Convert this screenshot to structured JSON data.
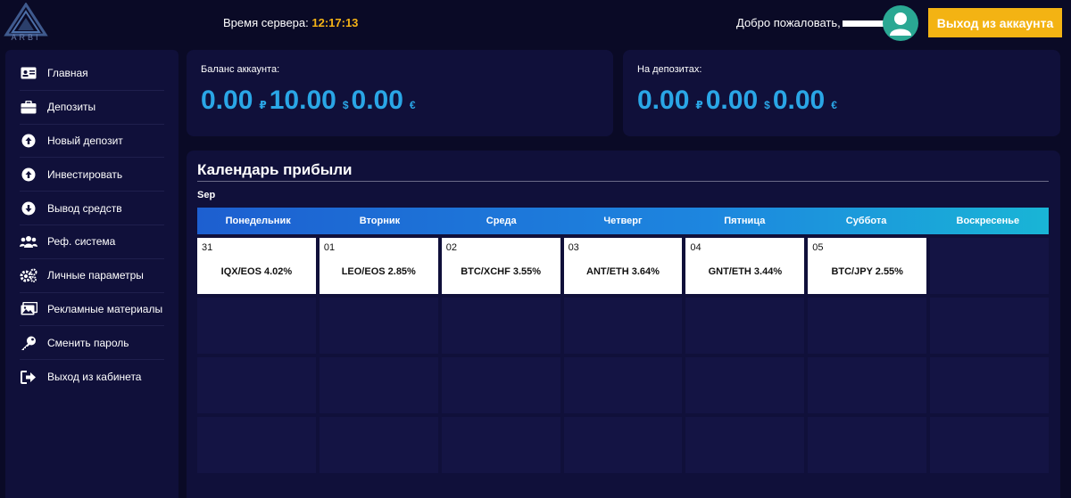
{
  "header": {
    "logo_text": "ARBI",
    "server_time_label": "Время сервера:",
    "server_time_value": "12:17:13",
    "welcome_text": "Добро пожаловать,",
    "logout_label": "Выход из аккаунта",
    "accent_color": "#f3b313"
  },
  "sidebar": {
    "items": [
      {
        "label": "Главная",
        "icon": "id-card-icon"
      },
      {
        "label": "Депозиты",
        "icon": "briefcase-icon"
      },
      {
        "label": "Новый депозит",
        "icon": "arrow-up-circle-icon"
      },
      {
        "label": "Инвестировать",
        "icon": "arrow-up-circle-icon"
      },
      {
        "label": "Вывод средств",
        "icon": "arrow-down-circle-icon"
      },
      {
        "label": "Реф. система",
        "icon": "users-icon"
      },
      {
        "label": "Личные параметры",
        "icon": "gears-icon"
      },
      {
        "label": "Рекламные материалы",
        "icon": "images-icon"
      },
      {
        "label": "Сменить пароль",
        "icon": "key-icon"
      },
      {
        "label": "Выход из кабинета",
        "icon": "sign-out-icon"
      }
    ]
  },
  "balance": {
    "label": "Баланс аккаунта:",
    "values": [
      {
        "amount": "0.00",
        "currency": "₽"
      },
      {
        "amount": "10.00",
        "currency": "$"
      },
      {
        "amount": "0.00",
        "currency": "€"
      }
    ]
  },
  "deposits": {
    "label": "На депозитах:",
    "values": [
      {
        "amount": "0.00",
        "currency": "₽"
      },
      {
        "amount": "0.00",
        "currency": "$"
      },
      {
        "amount": "0.00",
        "currency": "€"
      }
    ]
  },
  "calendar": {
    "title": "Календарь прибыли",
    "month": "Sep",
    "weekdays": [
      "Понедельник",
      "Вторник",
      "Среда",
      "Четверг",
      "Пятница",
      "Суббота",
      "Воскресенье"
    ],
    "first_week": [
      {
        "day": "31",
        "pair": "IQX/EOS 4.02%"
      },
      {
        "day": "01",
        "pair": "LEO/EOS 2.85%"
      },
      {
        "day": "02",
        "pair": "BTC/XCHF 3.55%"
      },
      {
        "day": "03",
        "pair": "ANT/ETH 3.64%"
      },
      {
        "day": "04",
        "pair": "GNT/ETH 3.44%"
      },
      {
        "day": "05",
        "pair": "BTC/JPY 2.55%"
      },
      {
        "day": "",
        "pair": ""
      }
    ],
    "value_color": "#2aa6e6"
  }
}
